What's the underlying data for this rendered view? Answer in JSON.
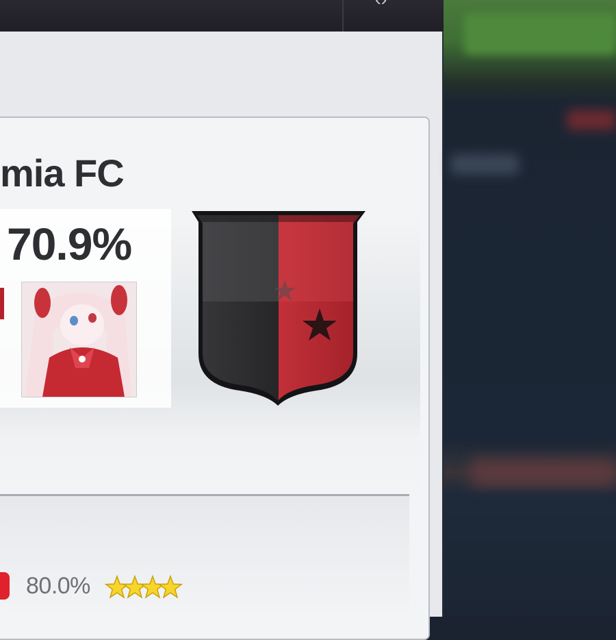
{
  "club": {
    "name": "mia FC"
  },
  "rating": {
    "value": "70.9%"
  },
  "lower_row": {
    "percentage": "80.0%",
    "stars": 4
  },
  "colors": {
    "crest_left": "#2b2b2e",
    "crest_right": "#b3252f",
    "badge": "#e0222c",
    "star": "#f7d52a"
  },
  "icons": {
    "crest": "club-crest-icon",
    "star": "star-icon",
    "avatar": "anime-avatar-image"
  }
}
